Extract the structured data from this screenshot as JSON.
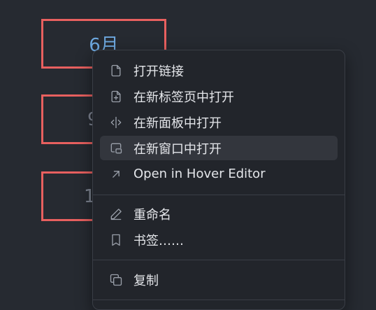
{
  "calendar": {
    "cell1": "6月",
    "cell2": "9",
    "cell3": "1"
  },
  "menu": {
    "items": [
      {
        "label": "打开链接",
        "icon": "file-icon"
      },
      {
        "label": "在新标签页中打开",
        "icon": "file-plus-icon"
      },
      {
        "label": "在新面板中打开",
        "icon": "split-icon"
      },
      {
        "label": "在新窗口中打开",
        "icon": "window-icon"
      },
      {
        "label": "Open in Hover Editor",
        "icon": "arrow-up-right-icon"
      },
      {
        "label": "重命名",
        "icon": "pencil-icon"
      },
      {
        "label": "书签……",
        "icon": "bookmark-icon"
      },
      {
        "label": "复制",
        "icon": "copy-icon"
      }
    ]
  }
}
